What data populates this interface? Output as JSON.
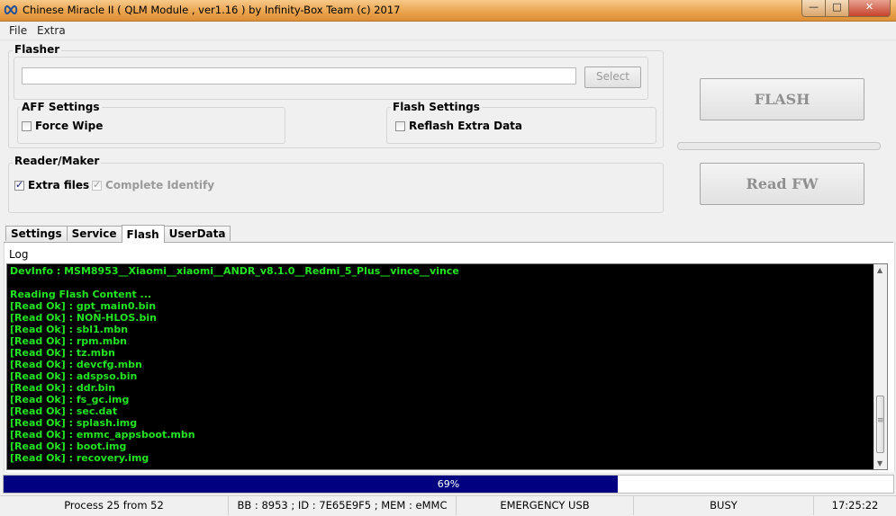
{
  "window": {
    "title": "Chinese Miracle II ( QLM Module , ver1.16  ) by Infinity-Box Team (c) 2017",
    "icon": "infinity-icon",
    "controls": {
      "minimize": "—",
      "maximize": "□",
      "close": "✕"
    }
  },
  "menu": {
    "items": [
      "File",
      "Extra"
    ]
  },
  "flasher": {
    "label": "Flasher",
    "path_value": "",
    "select_label": "Select"
  },
  "aff_settings": {
    "label": "AFF Settings",
    "force_wipe": {
      "label": "Force Wipe",
      "checked": false
    }
  },
  "flash_settings": {
    "label": "Flash Settings",
    "reflash_extra": {
      "label": "Reflash Extra Data",
      "checked": false
    }
  },
  "reader_maker": {
    "label": "Reader/Maker",
    "extra_files": {
      "label": "Extra files",
      "checked": true
    },
    "complete_identify": {
      "label": "Complete Identify",
      "checked": true,
      "disabled": true
    }
  },
  "actions": {
    "flash": "FLASH",
    "read_fw": "Read FW"
  },
  "tabs": [
    {
      "label": "Settings",
      "active": false
    },
    {
      "label": "Service",
      "active": false
    },
    {
      "label": "Flash",
      "active": true
    },
    {
      "label": "UserData",
      "active": false
    }
  ],
  "log": {
    "label": "Log",
    "lines": [
      "DevInfo : MSM8953__Xiaomi__xiaomi__ANDR_v8.1.0__Redmi_5_Plus__vince__vince",
      "",
      "Reading Flash Content ...",
      "[Read Ok] : gpt_main0.bin",
      "[Read Ok] : NON-HLOS.bin",
      "[Read Ok] : sbl1.mbn",
      "[Read Ok] : rpm.mbn",
      "[Read Ok] : tz.mbn",
      "[Read Ok] : devcfg.mbn",
      "[Read Ok] : adspso.bin",
      "[Read Ok] : ddr.bin",
      "[Read Ok] : fs_gc.img",
      "[Read Ok] : sec.dat",
      "[Read Ok] : splash.img",
      "[Read Ok] : emmc_appsboot.mbn",
      "[Read Ok] : boot.img",
      "[Read Ok] : recovery.img"
    ],
    "text_color": "#22e422",
    "background": "#000000"
  },
  "progress": {
    "percent": 69,
    "label": "69%",
    "color": "#000080"
  },
  "status": {
    "process": "Process 25 from 52",
    "device": "BB : 8953 ; ID : 7E65E9F5 ; MEM : eMMC",
    "mode": "EMERGENCY USB",
    "state": "BUSY",
    "time": "17:25:22"
  }
}
